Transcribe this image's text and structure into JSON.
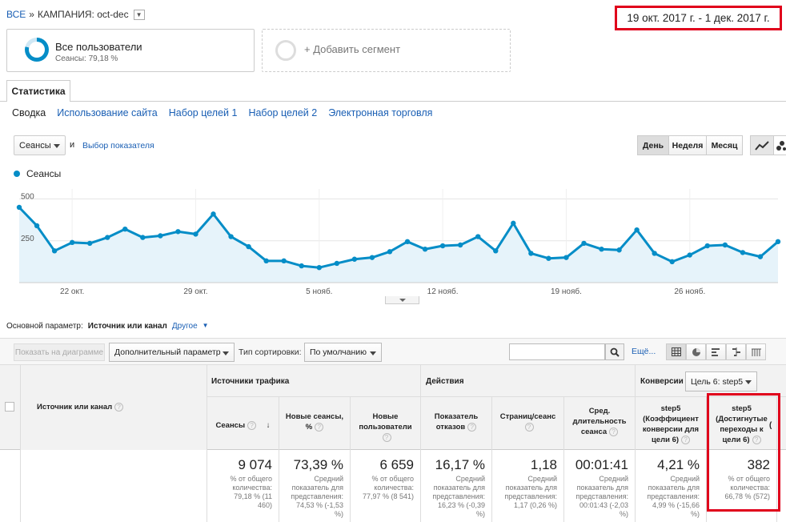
{
  "breadcrumb": {
    "all": "ВСЕ",
    "sep": "»",
    "campaign": "КАМПАНИЯ: oct-dec"
  },
  "date_range": "19 окт. 2017 г. - 1 дек. 2017 г.",
  "segment": {
    "title": "Все пользователи",
    "subtitle": "Сеансы: 79,18 %",
    "add": "+ Добавить сегмент"
  },
  "tabs": {
    "main": "Статистика",
    "sub": [
      "Сводка",
      "Использование сайта",
      "Набор целей 1",
      "Набор целей 2",
      "Электронная торговля"
    ]
  },
  "controls": {
    "metric": "Сеансы",
    "and": "и",
    "choose_metric": "Выбор показателя",
    "periods": [
      "День",
      "Неделя",
      "Месяц"
    ]
  },
  "colors": {
    "series": "#058dc7",
    "fill": "#e6f3fa",
    "highlight": "#e0001b"
  },
  "chart_data": {
    "type": "line",
    "legend": "Сеансы",
    "ylim": [
      0,
      560
    ],
    "yticks": [
      {
        "v": 500,
        "label": "500"
      },
      {
        "v": 250,
        "label": "250"
      }
    ],
    "xticks": [
      {
        "i": 3,
        "label": "22 окт."
      },
      {
        "i": 10,
        "label": "29 окт."
      },
      {
        "i": 17,
        "label": "5 нояб."
      },
      {
        "i": 24,
        "label": "12 нояб."
      },
      {
        "i": 31,
        "label": "19 нояб."
      },
      {
        "i": 38,
        "label": "26 нояб."
      }
    ],
    "values": [
      450,
      340,
      190,
      240,
      235,
      270,
      320,
      270,
      280,
      305,
      290,
      410,
      275,
      215,
      130,
      130,
      100,
      90,
      115,
      140,
      150,
      185,
      245,
      200,
      220,
      225,
      275,
      190,
      355,
      175,
      145,
      150,
      235,
      200,
      195,
      315,
      175,
      125,
      165,
      220,
      225,
      180,
      155,
      245
    ]
  },
  "primary": {
    "label": "Основной параметр:",
    "value": "Источник или канал",
    "other": "Другое"
  },
  "toolbar": {
    "plot": "Показать на диаграмме",
    "secondary": "Дополнительный параметр",
    "sort_label": "Тип сортировки:",
    "sort_value": "По умолчанию",
    "more": "Ещё..."
  },
  "table": {
    "dim_header": "Источник или канал",
    "groups": {
      "traffic": "Источники трафика",
      "actions": "Действия",
      "conversions": "Конверсии",
      "goal": "Цель 6: step5"
    },
    "cols": [
      {
        "h": "Сеансы",
        "v": "9 074",
        "s": "% от общего количества: 79,18 % (11 460)"
      },
      {
        "h": "Новые сеансы, %",
        "v": "73,39 %",
        "s": "Средний показатель для представления: 74,53 % (-1,53 %)"
      },
      {
        "h": "Новые пользователи",
        "v": "6 659",
        "s": "% от общего количества: 77,97 % (8 541)"
      },
      {
        "h": "Показатель отказов",
        "v": "16,17 %",
        "s": "Средний показатель для представления: 16,23 % (-0,39 %)"
      },
      {
        "h": "Страниц/сеанс",
        "v": "1,18",
        "s": "Средний показатель для представления: 1,17 (0,26 %)"
      },
      {
        "h": "Сред. длительность сеанса",
        "v": "00:01:41",
        "s": "Средний показатель для представления: 00:01:43 (-2,03 %)"
      },
      {
        "h": "step5 (Коэффициент конверсии для цели 6)",
        "v": "4,21 %",
        "s": "Средний показатель для представления: 4,99 % (-15,66 %)"
      },
      {
        "h": "step5 (Достигнутые переходы к цели 6)",
        "v": "382",
        "s": "% от общего количества: 66,78 % (572)"
      }
    ]
  }
}
